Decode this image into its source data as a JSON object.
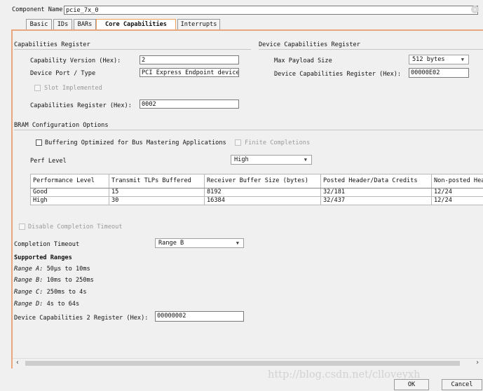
{
  "component": {
    "label": "Component Name",
    "value": "pcie_7x_0"
  },
  "tabs": [
    {
      "label": "Basic"
    },
    {
      "label": "IDs"
    },
    {
      "label": "BARs"
    },
    {
      "label": "Core Capabilities"
    },
    {
      "label": "Interrupts"
    }
  ],
  "cap_reg": {
    "title": "Capabilities Register",
    "version_label": "Capability Version (Hex):",
    "version_value": "2",
    "port_label": "Device Port / Type",
    "port_value": "PCI Express Endpoint device",
    "slot_label": "Slot Implemented",
    "reg_label": "Capabilities Register (Hex):",
    "reg_value": "0002"
  },
  "dev_cap_reg": {
    "title": "Device Capabilities Register",
    "payload_label": "Max Payload Size",
    "payload_value": "512 bytes",
    "reg_label": "Device Capabilities Register (Hex):",
    "reg_value": "00000E02"
  },
  "bram": {
    "title": "BRAM Configuration Options",
    "buffering_label": "Buffering Optimized for Bus Mastering Applications",
    "finite_label": "Finite Completions",
    "perf_label": "Perf Level",
    "perf_value": "High",
    "table": {
      "headers": [
        "Performance Level",
        "Transmit TLPs Buffered",
        "Receiver Buffer Size (bytes)",
        "Posted Header/Data Credits",
        "Non-posted Hea"
      ],
      "rows": [
        [
          "Good",
          "15",
          "8192",
          "32/181",
          "12/24"
        ],
        [
          "High",
          "30",
          "16384",
          "32/437",
          "12/24"
        ]
      ]
    }
  },
  "completion": {
    "disable_label": "Disable Completion Timeout",
    "timeout_label": "Completion Timeout",
    "timeout_value": "Range B",
    "supported_title": "Supported Ranges",
    "ranges": [
      {
        "name": "Range A:",
        "value": "50μs to 10ms"
      },
      {
        "name": "Range B:",
        "value": "10ms to 250ms"
      },
      {
        "name": "Range C:",
        "value": "250ms to 4s"
      },
      {
        "name": "Range D:",
        "value": "4s to 64s"
      }
    ],
    "dc2_label": "Device Capabilities 2 Register (Hex):",
    "dc2_value": "00000002"
  },
  "watermark": "http://blog.csdn.net/clloveyxh",
  "buttons": {
    "ok": "OK",
    "cancel": "Cancel"
  },
  "icons": {
    "clear": "clear-icon",
    "scroll_left": "chevron-left-icon",
    "scroll_right": "chevron-right-icon",
    "dropdown": "triangle-down-icon"
  },
  "colors": {
    "accent_tab": "#f3a35c",
    "panel_border": "#e8a77c"
  }
}
